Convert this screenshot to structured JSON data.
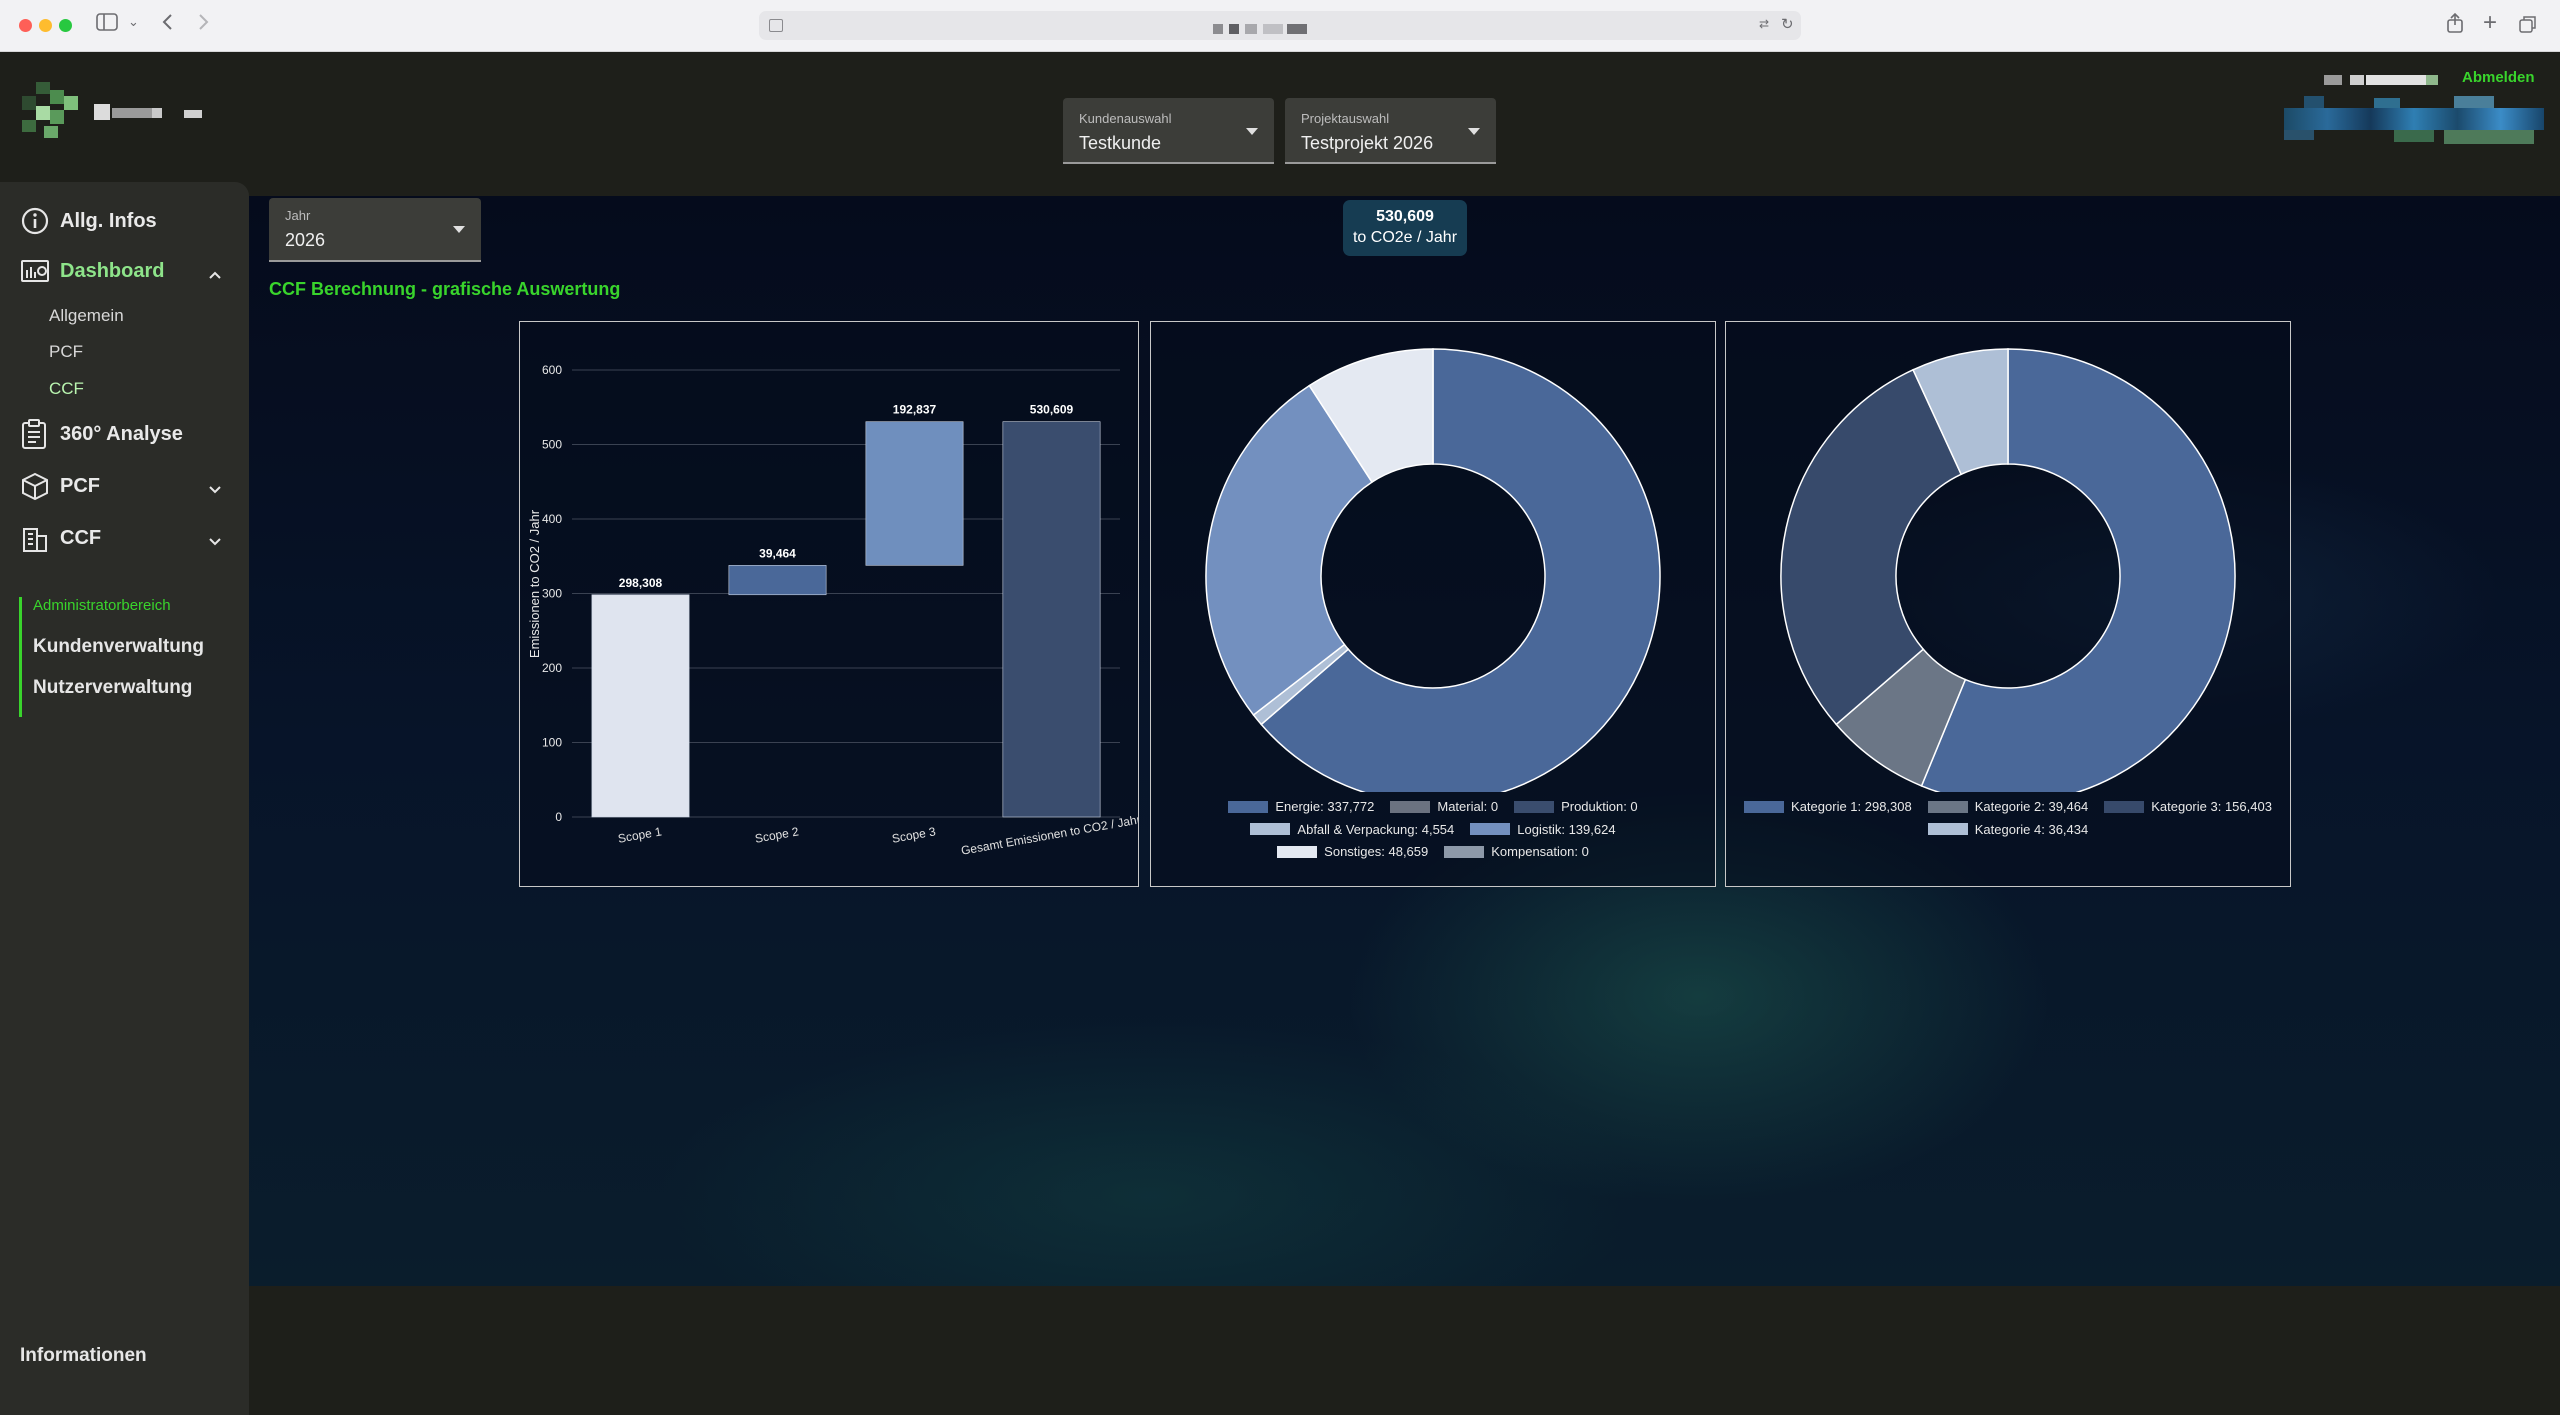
{
  "app": {
    "logout_label": "Abmelden",
    "colors": {
      "accent_green": "#39d42c",
      "panel_bg": "#2b2c28"
    }
  },
  "header": {
    "customer_select": {
      "label": "Kundenauswahl",
      "value": "Testkunde"
    },
    "project_select": {
      "label": "Projektauswahl",
      "value": "Testprojekt 2026"
    }
  },
  "sidebar": {
    "items": [
      {
        "label": "Allg. Infos",
        "icon": "info-icon"
      },
      {
        "label": "Dashboard",
        "icon": "dashboard-icon"
      },
      {
        "label": "360° Analyse",
        "icon": "clipboard-icon"
      },
      {
        "label": "PCF",
        "icon": "box-icon"
      },
      {
        "label": "CCF",
        "icon": "building-icon"
      }
    ],
    "dashboard_sub": [
      "Allgemein",
      "PCF",
      "CCF"
    ],
    "admin": {
      "title": "Administratorbereich",
      "items": [
        "Kundenverwaltung",
        "Nutzerverwaltung"
      ]
    },
    "footer_label": "Informationen"
  },
  "main": {
    "year_select": {
      "label": "Jahr",
      "value": "2026"
    },
    "total_badge": {
      "value": "530,609",
      "unit": "to CO2e / Jahr"
    },
    "section_title": "CCF Berechnung - grafische Auswertung"
  },
  "chart_data": [
    {
      "type": "bar",
      "subtype": "waterfall",
      "categories": [
        "Scope 1",
        "Scope 2",
        "Scope 3",
        "Gesamt Emissionen  to CO2 / Jahr"
      ],
      "values": [
        298.308,
        39.464,
        192.837,
        530.609
      ],
      "data_labels": [
        "298,308",
        "39,464",
        "192,837",
        "530,609"
      ],
      "ylabel": "Emissionen to CO2 / Jahr",
      "ylim": [
        0,
        600
      ],
      "yticks": [
        "0",
        "100",
        "200",
        "300",
        "400",
        "500",
        "600"
      ],
      "colors": [
        "#dfe4ef",
        "#4a6899",
        "#6f8fbe",
        "#3a4d6e"
      ],
      "grid": true
    },
    {
      "type": "pie",
      "subtype": "donut",
      "labels": [
        "Energie",
        "Material",
        "Produktion",
        "Abfall & Verpackung",
        "Logistik",
        "Sonstiges",
        "Kompensation"
      ],
      "values": [
        337772,
        0,
        0,
        4554,
        139624,
        48659,
        0
      ],
      "legend": [
        "Energie: 337,772",
        "Material: 0",
        "Produktion: 0",
        "Abfall & Verpackung: 4,554",
        "Logistik: 139,624",
        "Sonstiges: 48,659",
        "Kompensation: 0"
      ],
      "colors": [
        "#4a6899",
        "#6b7280",
        "#3a4d6e",
        "#aebfd6",
        "#7390bf",
        "#e4e9f2",
        "#8d99a9"
      ],
      "legend_position": "bottom"
    },
    {
      "type": "pie",
      "subtype": "donut",
      "labels": [
        "Kategorie 1",
        "Kategorie 2",
        "Kategorie 3",
        "Kategorie 4"
      ],
      "values": [
        298308,
        39464,
        156403,
        36434
      ],
      "legend": [
        "Kategorie 1: 298,308",
        "Kategorie 2: 39,464",
        "Kategorie 3: 156,403",
        "Kategorie 4: 36,434"
      ],
      "colors": [
        "#4a6899",
        "#6b7686",
        "#374a6b",
        "#aebfd6"
      ],
      "legend_position": "bottom"
    }
  ]
}
